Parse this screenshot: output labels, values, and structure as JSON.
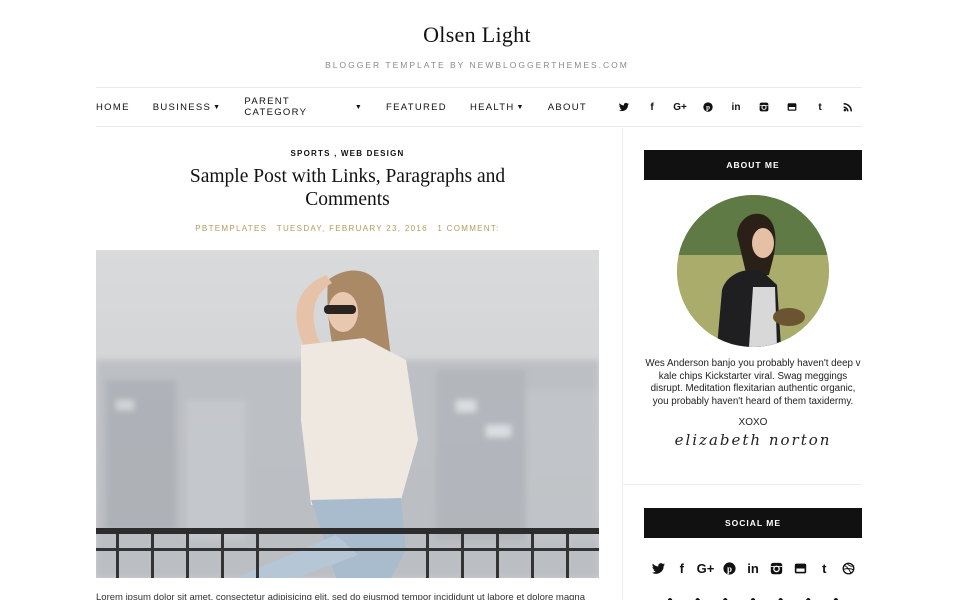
{
  "site": {
    "title": "Olsen Light",
    "tagline": "BLOGGER TEMPLATE BY NEWBLOGGERTHEMES.COM"
  },
  "nav": {
    "items": [
      {
        "label": "HOME",
        "dropdown": false
      },
      {
        "label": "BUSINESS",
        "dropdown": true
      },
      {
        "label": "PARENT CATEGORY",
        "dropdown": true
      },
      {
        "label": "FEATURED",
        "dropdown": false
      },
      {
        "label": "HEALTH",
        "dropdown": true
      },
      {
        "label": "ABOUT",
        "dropdown": false
      }
    ],
    "social_icons": [
      "twitter-icon",
      "facebook-icon",
      "google-plus-icon",
      "pinterest-icon",
      "linkedin-icon",
      "instagram-icon",
      "youtube-icon",
      "tumblr-icon",
      "rss-icon"
    ]
  },
  "post": {
    "categories": [
      "SPORTS",
      ", WEB DESIGN"
    ],
    "title": "Sample Post with Links, Paragraphs and Comments",
    "author": "PBTEMPLATES",
    "date": "TUESDAY, FEBRUARY 23, 2016",
    "comments": "1 COMMENT:",
    "excerpt": "Lorem ipsum dolor sit amet, consectetur adipisicing elit, sed do eiusmod tempor incididunt ut labore et dolore magna"
  },
  "sidebar": {
    "about": {
      "title": "ABOUT ME",
      "text": "Wes Anderson banjo you probably haven't deep v kale chips Kickstarter viral. Swag meggings disrupt. Meditation flexitarian authentic organic, you probably haven't heard of them taxidermy.",
      "sign_off": "XOXO",
      "signature": "elizabeth norton"
    },
    "social": {
      "title": "SOCIAL ME",
      "icons": [
        "twitter-icon",
        "facebook-icon",
        "google-plus-icon",
        "pinterest-icon",
        "linkedin-icon",
        "instagram-icon",
        "youtube-icon",
        "tumblr-icon",
        "dribbble-icon"
      ]
    }
  },
  "colors": {
    "accent": "#b59a5d",
    "widget_bg": "#111111",
    "divider": "#ececec"
  }
}
